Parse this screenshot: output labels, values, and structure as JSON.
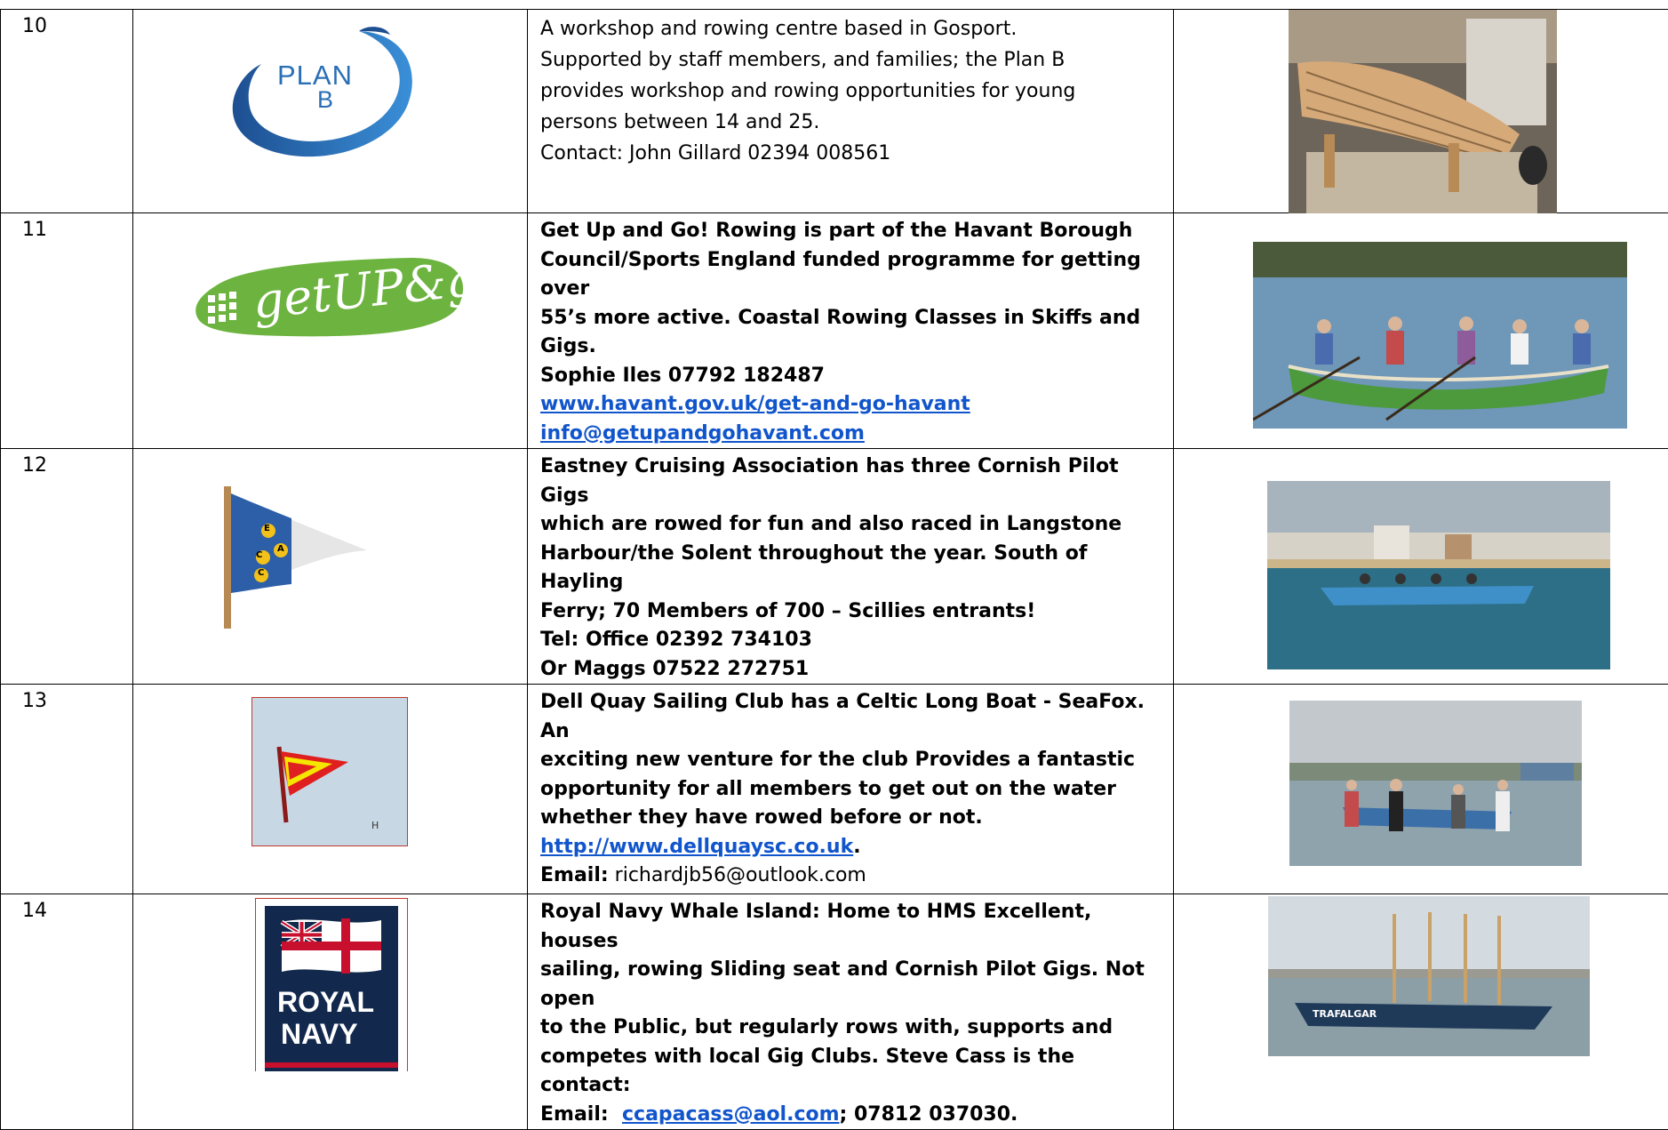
{
  "rows": [
    {
      "number": "10",
      "logo": {
        "text_line1": "PLAN",
        "text_line2": "B"
      },
      "lines": [
        "A workshop and rowing centre based in Gosport.",
        "Supported by staff members, and families; the Plan B",
        "provides workshop and rowing opportunities for young",
        "persons between 14 and 25.",
        "Contact: John Gillard 02394 008561"
      ]
    },
    {
      "number": "11",
      "logo": {
        "text": "getUP&go!"
      },
      "lines": [
        "Get Up and Go! Rowing is part of the Havant Borough",
        "Council/Sports England funded programme for getting over",
        "55’s more active. Coastal Rowing Classes in Skiffs and Gigs.",
        "Sophie Iles 07792 182487"
      ],
      "link1": "www.havant.gov.uk/get-and-go-havant",
      "link2": "info@getupandgohavant.com"
    },
    {
      "number": "12",
      "logo": {
        "letters": [
          "E",
          "C",
          "A",
          "C"
        ]
      },
      "lines": [
        "Eastney Cruising Association has three Cornish Pilot Gigs",
        "which are rowed for fun and also raced in Langstone",
        "Harbour/the Solent throughout the year. South of Hayling",
        "Ferry; 70 Members of 700 – Scillies entrants!",
        "Tel: Office 02392 734103",
        "Or Maggs 07522 272751"
      ]
    },
    {
      "number": "13",
      "logo": {
        "mark": "H"
      },
      "lines": [
        "Dell Quay Sailing Club has a Celtic Long Boat - SeaFox.  An",
        "exciting new venture for the club Provides a fantastic",
        "opportunity for all members to get out on the water",
        "whether they have rowed before or not."
      ],
      "link": "http://www.dellquaysc.co.uk",
      "link_suffix": ".",
      "email_label": "Email:",
      "email_value": " richardjb56@outlook.com"
    },
    {
      "number": "14",
      "logo": {
        "line1": "ROYAL",
        "line2": "NAVY"
      },
      "lines": [
        "Royal Navy Whale Island: Home to HMS Excellent, houses",
        "sailing, rowing Sliding seat and Cornish Pilot Gigs. Not open",
        "to the Public, but regularly rows with, supports and",
        "competes with local Gig Clubs. Steve Cass is the contact:"
      ],
      "email_label": "Email:  ",
      "email_link": "ccapacass@aol.com",
      "email_suffix": "; 07812 037030.",
      "boat_name": "TRAFALGAR"
    }
  ],
  "colors": {
    "link": "#1155cc",
    "planb_blue": "#2a6fb5",
    "getupgo_green": "#6cb33f",
    "navy_blue": "#12284c",
    "navy_red": "#c8102e"
  }
}
